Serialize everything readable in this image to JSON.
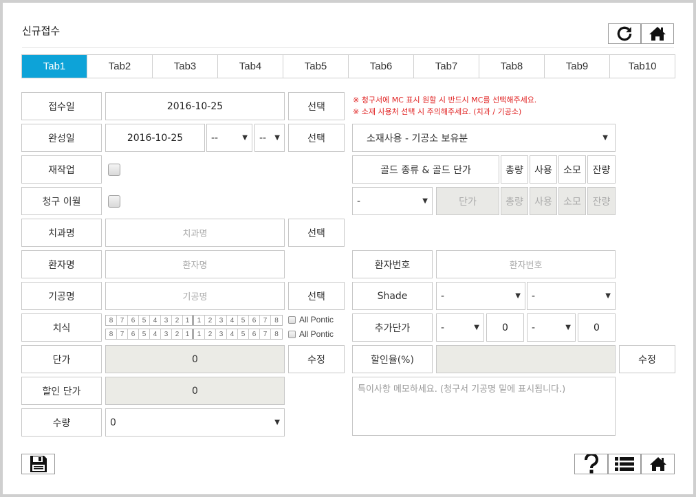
{
  "page": {
    "title": "신규접수",
    "icons": {
      "refresh": "refresh-icon",
      "home": "home-icon",
      "save": "floppy-icon",
      "help": "question-icon",
      "list": "list-icon"
    }
  },
  "tabs": [
    "Tab1",
    "Tab2",
    "Tab3",
    "Tab4",
    "Tab5",
    "Tab6",
    "Tab7",
    "Tab8",
    "Tab9",
    "Tab10"
  ],
  "active_tab": "Tab1",
  "notes": [
    "※ 청구서에 MC 표시 원할 시 반드시 MC를 선택해주세요.",
    "※ 소재 사용처 선택 시 주의해주세요. (치과 / 기공소)"
  ],
  "form": {
    "receipt_date": {
      "label": "접수일",
      "value": "2016-10-25",
      "button": "선택"
    },
    "complete_date": {
      "label": "완성일",
      "value": "2016-10-25",
      "hour": "--",
      "minute": "--",
      "button": "선택"
    },
    "remake": {
      "label": "재작업"
    },
    "bill_carryover": {
      "label": "청구 이월"
    },
    "clinic": {
      "label": "치과명",
      "placeholder": "치과명",
      "button": "선택"
    },
    "patient": {
      "label": "환자명",
      "placeholder": "환자명"
    },
    "technician": {
      "label": "기공명",
      "placeholder": "기공명",
      "button": "선택"
    },
    "teeth": {
      "label": "치식",
      "upper": [
        "8",
        "7",
        "6",
        "5",
        "4",
        "3",
        "2",
        "1",
        "1",
        "2",
        "3",
        "4",
        "5",
        "6",
        "7",
        "8"
      ],
      "lower": [
        "8",
        "7",
        "6",
        "5",
        "4",
        "3",
        "2",
        "1",
        "1",
        "2",
        "3",
        "4",
        "5",
        "6",
        "7",
        "8"
      ],
      "pontic_label": "All Pontic"
    },
    "unit_price": {
      "label": "단가",
      "value": "0",
      "button": "수정"
    },
    "discount_price": {
      "label": "할인 단가",
      "value": "0"
    },
    "quantity": {
      "label": "수량",
      "value": "0"
    }
  },
  "material": {
    "usage_select": "소재사용 - 기공소 보유분",
    "gold_header": "골드 종류 & 골드 단가",
    "headers": [
      "총량",
      "사용",
      "소모",
      "잔량"
    ],
    "gold_select": "-",
    "price_label": "단가",
    "row_values": [
      "총량",
      "사용",
      "소모",
      "잔량"
    ]
  },
  "right": {
    "patient_no": {
      "label": "환자번호",
      "placeholder": "환자번호"
    },
    "shade": {
      "label": "Shade",
      "select1": "-",
      "select2": "-"
    },
    "extra_price": {
      "label": "추가단가",
      "select1": "-",
      "value1": "0",
      "select2": "-",
      "value2": "0"
    },
    "discount_rate": {
      "label": "할인율(%)",
      "button": "수정"
    },
    "memo_placeholder": "특이사항 메모하세요. (청구서 기공명 밑에 표시됩니다.)"
  }
}
